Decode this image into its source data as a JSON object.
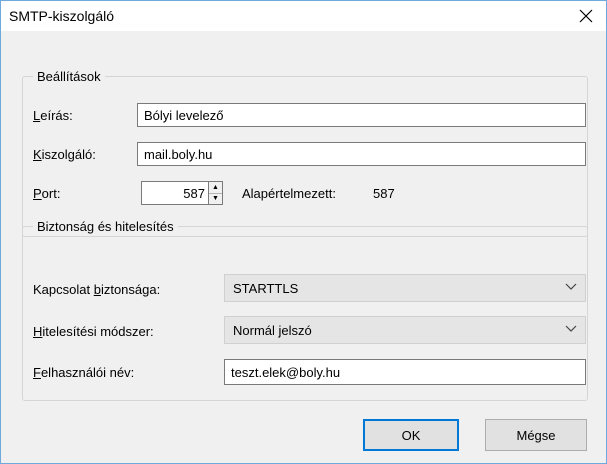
{
  "window": {
    "title": "SMTP-kiszolgáló"
  },
  "settings": {
    "legend": "Beállítások",
    "description_label_first": "L",
    "description_label_rest": "eírás:",
    "description_value": "Bólyi levelező",
    "server_label_first": "K",
    "server_label_rest": "iszolgáló:",
    "server_value": "mail.boly.hu",
    "port_label_first": "P",
    "port_label_rest": "ort:",
    "port_value": "587",
    "default_label": "Alapértelmezett:",
    "default_value": "587"
  },
  "security": {
    "legend": "Biztonság és hitelesítés",
    "conn_label_pre": "Kapcsolat ",
    "conn_label_accel": "b",
    "conn_label_post": "iztonsága:",
    "conn_value": "STARTTLS",
    "auth_label_accel": "H",
    "auth_label_post": "itelesítési módszer:",
    "auth_value": "Normál jelszó",
    "user_label_accel": "F",
    "user_label_post": "elhasználói név:",
    "user_value": "teszt.elek@boly.hu"
  },
  "buttons": {
    "ok": "OK",
    "cancel": "Mégse"
  },
  "icons": {
    "close": "close-icon",
    "chevron": "chevron-down-icon",
    "spin_up": "spin-up-icon",
    "spin_down": "spin-down-icon"
  },
  "colors": {
    "accent": "#0078d7",
    "window_border": "#6fa8dc"
  }
}
